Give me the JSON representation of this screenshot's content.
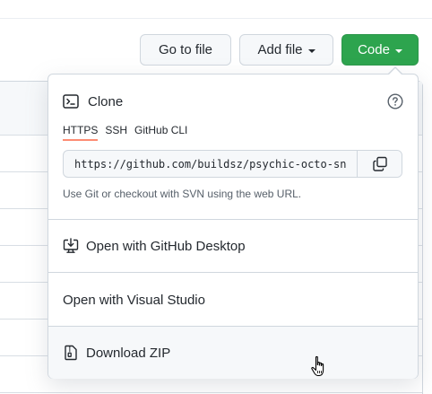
{
  "toolbar": {
    "goto_label": "Go to file",
    "addfile_label": "Add file",
    "code_label": "Code"
  },
  "clone": {
    "title": "Clone",
    "tabs": [
      {
        "label": "HTTPS",
        "active": true
      },
      {
        "label": "SSH",
        "active": false
      },
      {
        "label": "GitHub CLI",
        "active": false
      }
    ],
    "url": "https://github.com/buildsz/psychic-octo-sniffle.git",
    "hint": "Use Git or checkout with SVN using the web URL."
  },
  "menu": {
    "open_desktop": "Open with GitHub Desktop",
    "open_vs": "Open with Visual Studio",
    "download_zip": "Download ZIP"
  },
  "icons": {
    "clone": "terminal-icon",
    "help": "question-icon",
    "copy": "copy-icon",
    "desktop": "desktop-download-icon",
    "zip": "file-zip-icon",
    "cursor": "hand-pointer-icon"
  },
  "colors": {
    "code_button": "#2da44e",
    "active_tab_underline": "#fd8c73",
    "hover_row": "#f6f8fa"
  }
}
